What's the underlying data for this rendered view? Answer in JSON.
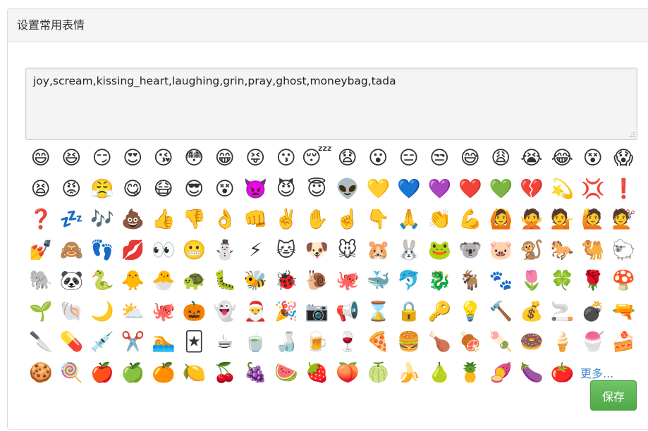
{
  "panel": {
    "title": "设置常用表情",
    "codes_value": "joy,scream,kissing_heart,laughing,grin,pray,ghost,moneybag,tada",
    "more_label": "更多...",
    "save_label": "保存",
    "accent_color": "#5cb85c",
    "link_color": "#428bca"
  },
  "emoji_rows": [
    [
      {
        "n": "smile",
        "c": "😄"
      },
      {
        "n": "laughing",
        "c": "😆"
      },
      {
        "n": "smirk",
        "c": "😏"
      },
      {
        "n": "heart-eyes",
        "c": "😍"
      },
      {
        "n": "kissing-heart",
        "c": "😘"
      },
      {
        "n": "flushed",
        "c": "😳"
      },
      {
        "n": "grin",
        "c": "😁"
      },
      {
        "n": "tongue-closed-eyes",
        "c": "😝"
      },
      {
        "n": "kissing",
        "c": "😗"
      },
      {
        "n": "sleeping",
        "c": "😴"
      },
      {
        "n": "anguished",
        "c": "😧"
      },
      {
        "n": "open-mouth",
        "c": "😮"
      },
      {
        "n": "expressionless",
        "c": "😑"
      },
      {
        "n": "unamused",
        "c": "😒"
      },
      {
        "n": "sweat-smile",
        "c": "😅"
      },
      {
        "n": "weary",
        "c": "😩"
      },
      {
        "n": "sob",
        "c": "😭"
      },
      {
        "n": "joy",
        "c": "😂"
      },
      {
        "n": "dizzy-face",
        "c": "😵"
      },
      {
        "n": "scream",
        "c": "😱"
      }
    ],
    [
      {
        "n": "tired-face",
        "c": "😫"
      },
      {
        "n": "rage",
        "c": "😡"
      },
      {
        "n": "triumph",
        "c": "😤"
      },
      {
        "n": "yum",
        "c": "😋"
      },
      {
        "n": "mask",
        "c": "😷"
      },
      {
        "n": "sunglasses",
        "c": "😎"
      },
      {
        "n": "dizzy-face-2",
        "c": "😵"
      },
      {
        "n": "imp",
        "c": "👿"
      },
      {
        "n": "smiling-imp",
        "c": "😈"
      },
      {
        "n": "innocent",
        "c": "😇"
      },
      {
        "n": "alien",
        "c": "👽"
      },
      {
        "n": "yellow-heart",
        "c": "💛"
      },
      {
        "n": "blue-heart",
        "c": "💙"
      },
      {
        "n": "purple-heart",
        "c": "💜"
      },
      {
        "n": "heart",
        "c": "❤️"
      },
      {
        "n": "green-heart",
        "c": "💚"
      },
      {
        "n": "broken-heart",
        "c": "💔"
      },
      {
        "n": "dizzy",
        "c": "💫"
      },
      {
        "n": "anger",
        "c": "💢"
      },
      {
        "n": "exclamation",
        "c": "❗"
      }
    ],
    [
      {
        "n": "question",
        "c": "❓"
      },
      {
        "n": "zzz",
        "c": "💤"
      },
      {
        "n": "notes",
        "c": "🎶"
      },
      {
        "n": "poop",
        "c": "💩"
      },
      {
        "n": "thumbsup",
        "c": "👍"
      },
      {
        "n": "thumbsdown",
        "c": "👎"
      },
      {
        "n": "ok-hand",
        "c": "👌"
      },
      {
        "n": "punch",
        "c": "👊"
      },
      {
        "n": "v",
        "c": "✌️"
      },
      {
        "n": "raised-hand",
        "c": "✋"
      },
      {
        "n": "point-up",
        "c": "☝️"
      },
      {
        "n": "point-down",
        "c": "👇"
      },
      {
        "n": "pray",
        "c": "🙏"
      },
      {
        "n": "clap",
        "c": "👏"
      },
      {
        "n": "muscle",
        "c": "💪"
      },
      {
        "n": "ok-woman",
        "c": "🙆"
      },
      {
        "n": "no-good",
        "c": "🙅"
      },
      {
        "n": "information-desk-person",
        "c": "💁"
      },
      {
        "n": "raising-hand",
        "c": "🙋"
      },
      {
        "n": "haircut",
        "c": "💇"
      }
    ],
    [
      {
        "n": "nail-care",
        "c": "💅"
      },
      {
        "n": "see-no-evil",
        "c": "🙈"
      },
      {
        "n": "feet",
        "c": "👣"
      },
      {
        "n": "lips",
        "c": "💋"
      },
      {
        "n": "eyes",
        "c": "👀"
      },
      {
        "n": "trollface",
        "c": "😬"
      },
      {
        "n": "snowman",
        "c": "⛄"
      },
      {
        "n": "zap",
        "c": "⚡"
      },
      {
        "n": "cat",
        "c": "🐱"
      },
      {
        "n": "dog",
        "c": "🐶"
      },
      {
        "n": "mouse",
        "c": "🐭"
      },
      {
        "n": "hamster",
        "c": "🐹"
      },
      {
        "n": "rabbit",
        "c": "🐰"
      },
      {
        "n": "frog",
        "c": "🐸"
      },
      {
        "n": "koala",
        "c": "🐨"
      },
      {
        "n": "pig",
        "c": "🐷"
      },
      {
        "n": "monkey",
        "c": "🐒"
      },
      {
        "n": "horse",
        "c": "🐎"
      },
      {
        "n": "camel",
        "c": "🐫"
      },
      {
        "n": "sheep",
        "c": "🐑"
      }
    ],
    [
      {
        "n": "elephant",
        "c": "🐘"
      },
      {
        "n": "panda",
        "c": "🐼"
      },
      {
        "n": "snake",
        "c": "🐍"
      },
      {
        "n": "chick",
        "c": "🐥"
      },
      {
        "n": "hatching-chick",
        "c": "🐣"
      },
      {
        "n": "turtle",
        "c": "🐢"
      },
      {
        "n": "bug",
        "c": "🐛"
      },
      {
        "n": "bee",
        "c": "🐝"
      },
      {
        "n": "beetle",
        "c": "🐞"
      },
      {
        "n": "snail",
        "c": "🐌"
      },
      {
        "n": "octopus",
        "c": "🐙"
      },
      {
        "n": "whale",
        "c": "🐳"
      },
      {
        "n": "dolphin",
        "c": "🐬"
      },
      {
        "n": "dragon",
        "c": "🐉"
      },
      {
        "n": "goat",
        "c": "🐐"
      },
      {
        "n": "paw-prints",
        "c": "🐾"
      },
      {
        "n": "tulip",
        "c": "🌷"
      },
      {
        "n": "four-leaf-clover",
        "c": "🍀"
      },
      {
        "n": "rose",
        "c": "🌹"
      },
      {
        "n": "mushroom",
        "c": "🍄"
      }
    ],
    [
      {
        "n": "seedling",
        "c": "🌱"
      },
      {
        "n": "shell",
        "c": "🐚"
      },
      {
        "n": "crescent-moon",
        "c": "🌙"
      },
      {
        "n": "partly-sunny",
        "c": "⛅"
      },
      {
        "n": "octocat",
        "c": "🐙"
      },
      {
        "n": "jack-o-lantern",
        "c": "🎃"
      },
      {
        "n": "ghost",
        "c": "👻"
      },
      {
        "n": "santa",
        "c": "🎅"
      },
      {
        "n": "tada",
        "c": "🎉"
      },
      {
        "n": "camera",
        "c": "📷"
      },
      {
        "n": "loudspeaker",
        "c": "📢"
      },
      {
        "n": "hourglass",
        "c": "⌛"
      },
      {
        "n": "lock",
        "c": "🔒"
      },
      {
        "n": "key",
        "c": "🔑"
      },
      {
        "n": "bulb",
        "c": "💡"
      },
      {
        "n": "hammer",
        "c": "🔨"
      },
      {
        "n": "moneybag",
        "c": "💰"
      },
      {
        "n": "smoking",
        "c": "🚬"
      },
      {
        "n": "bomb",
        "c": "💣"
      },
      {
        "n": "gun",
        "c": "🔫"
      }
    ],
    [
      {
        "n": "hocho",
        "c": "🔪"
      },
      {
        "n": "pill",
        "c": "💊"
      },
      {
        "n": "syringe",
        "c": "💉"
      },
      {
        "n": "scissors",
        "c": "✂️"
      },
      {
        "n": "swimmer",
        "c": "🏊"
      },
      {
        "n": "black-joker",
        "c": "🃏"
      },
      {
        "n": "coffee",
        "c": "☕"
      },
      {
        "n": "tea",
        "c": "🍵"
      },
      {
        "n": "sake",
        "c": "🍶"
      },
      {
        "n": "beer",
        "c": "🍺"
      },
      {
        "n": "wine-glass",
        "c": "🍷"
      },
      {
        "n": "pizza",
        "c": "🍕"
      },
      {
        "n": "hamburger",
        "c": "🍔"
      },
      {
        "n": "poultry-leg",
        "c": "🍗"
      },
      {
        "n": "meat-on-bone",
        "c": "🍖"
      },
      {
        "n": "dango",
        "c": "🍡"
      },
      {
        "n": "doughnut",
        "c": "🍩"
      },
      {
        "n": "icecream",
        "c": "🍦"
      },
      {
        "n": "shaved-ice",
        "c": "🍧"
      },
      {
        "n": "cake",
        "c": "🍰"
      }
    ],
    [
      {
        "n": "cookie",
        "c": "🍪"
      },
      {
        "n": "lollipop",
        "c": "🍭"
      },
      {
        "n": "apple",
        "c": "🍎"
      },
      {
        "n": "green-apple",
        "c": "🍏"
      },
      {
        "n": "tangerine",
        "c": "🍊"
      },
      {
        "n": "lemon",
        "c": "🍋"
      },
      {
        "n": "cherries",
        "c": "🍒"
      },
      {
        "n": "grapes",
        "c": "🍇"
      },
      {
        "n": "watermelon",
        "c": "🍉"
      },
      {
        "n": "strawberry",
        "c": "🍓"
      },
      {
        "n": "peach",
        "c": "🍑"
      },
      {
        "n": "melon",
        "c": "🍈"
      },
      {
        "n": "banana",
        "c": "🍌"
      },
      {
        "n": "pear",
        "c": "🍐"
      },
      {
        "n": "pineapple",
        "c": "🍍"
      },
      {
        "n": "sweet-potato",
        "c": "🍠"
      },
      {
        "n": "eggplant",
        "c": "🍆"
      },
      {
        "n": "tomato",
        "c": "🍅"
      }
    ]
  ]
}
